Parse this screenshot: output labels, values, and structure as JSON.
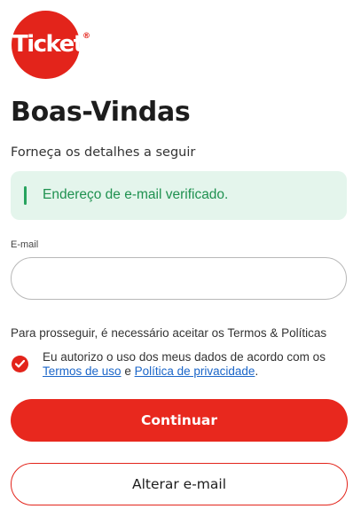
{
  "brand": {
    "logo_text": "Ticket",
    "logo_reg": "®",
    "color": "#e3241b"
  },
  "header": {
    "title": "Boas-Vindas",
    "subtitle": "Forneça os detalhes a seguir"
  },
  "alert": {
    "message": "Endereço de e-mail verificado.",
    "status_color": "#27a35e"
  },
  "form": {
    "email_label": "E-mail",
    "email_value": "",
    "email_placeholder": ""
  },
  "terms": {
    "info": "Para prosseguir, é necessário aceitar os Termos & Políticas",
    "checkbox_checked": true,
    "consent_text": "Eu autorizo o uso dos meus dados de acordo com os",
    "terms_link": "Termos de uso",
    "conjunction": "e",
    "privacy_link": "Política de privacidade",
    "end": "."
  },
  "actions": {
    "continue_label": "Continuar",
    "change_email_label": "Alterar e-mail"
  }
}
